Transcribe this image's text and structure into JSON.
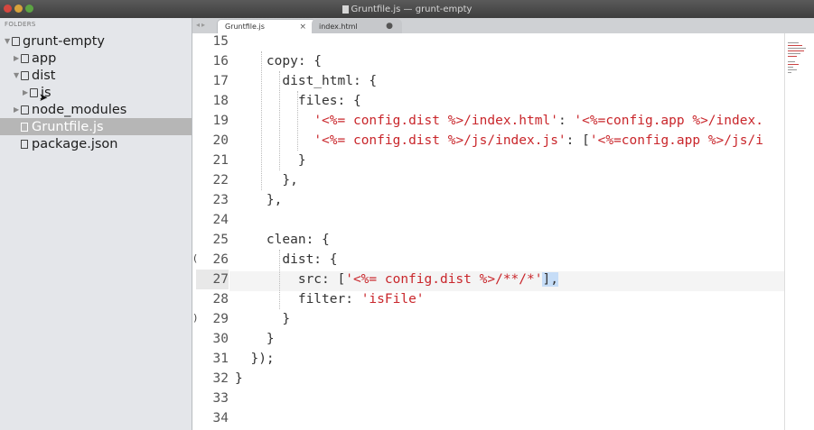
{
  "window": {
    "title": "Gruntfile.js — grunt-empty"
  },
  "sidebar": {
    "header": "FOLDERS",
    "items": [
      {
        "label": "grunt-empty",
        "kind": "folder-open",
        "depth": 0,
        "arrow": "▼"
      },
      {
        "label": "app",
        "kind": "folder",
        "depth": 1,
        "arrow": "▶"
      },
      {
        "label": "dist",
        "kind": "folder-open",
        "depth": 1,
        "arrow": "▼"
      },
      {
        "label": "js",
        "kind": "folder",
        "depth": 2,
        "arrow": "▶"
      },
      {
        "label": "node_modules",
        "kind": "folder",
        "depth": 1,
        "arrow": "▶"
      },
      {
        "label": "Gruntfile.js",
        "kind": "file",
        "depth": 1,
        "selected": true
      },
      {
        "label": "package.json",
        "kind": "file",
        "depth": 1
      }
    ]
  },
  "tabs": [
    {
      "label": "Gruntfile.js",
      "active": true,
      "close": "×"
    },
    {
      "label": "index.html",
      "active": false,
      "close": "●"
    }
  ],
  "editor": {
    "current_line": "27",
    "lines": [
      {
        "num": "15",
        "text": ""
      },
      {
        "num": "16",
        "text": "    copy: {"
      },
      {
        "num": "17",
        "text": "      dist_html: {"
      },
      {
        "num": "18",
        "text": "        files: {"
      },
      {
        "num": "19",
        "pre": "          ",
        "s1": "'<%= config.dist %>/index.html'",
        "mid": ": ",
        "s2": "'<%=config.app %>/index.",
        "post": ""
      },
      {
        "num": "20",
        "pre": "          ",
        "s1": "'<%= config.dist %>/js/index.js'",
        "mid": ": [",
        "s2": "'<%=config.app %>/js/i",
        "post": ""
      },
      {
        "num": "21",
        "text": "        }"
      },
      {
        "num": "22",
        "text": "      },"
      },
      {
        "num": "23",
        "text": "    },"
      },
      {
        "num": "24",
        "text": ""
      },
      {
        "num": "25",
        "text": "    clean: {"
      },
      {
        "num": "26",
        "text": "      dist: {"
      },
      {
        "num": "27",
        "pre": "        src: [",
        "s1": "'<%= config.dist %>/**/*'",
        "mid": "",
        "s2": "",
        "post": "],"
      },
      {
        "num": "28",
        "pre": "        filter: ",
        "s1": "'isFile'",
        "mid": "",
        "s2": "",
        "post": ""
      },
      {
        "num": "29",
        "text": "      }"
      },
      {
        "num": "30",
        "text": "    }"
      },
      {
        "num": "31",
        "text": "  });"
      },
      {
        "num": "32",
        "text": "}"
      },
      {
        "num": "33",
        "text": ""
      },
      {
        "num": "34",
        "text": ""
      }
    ]
  }
}
